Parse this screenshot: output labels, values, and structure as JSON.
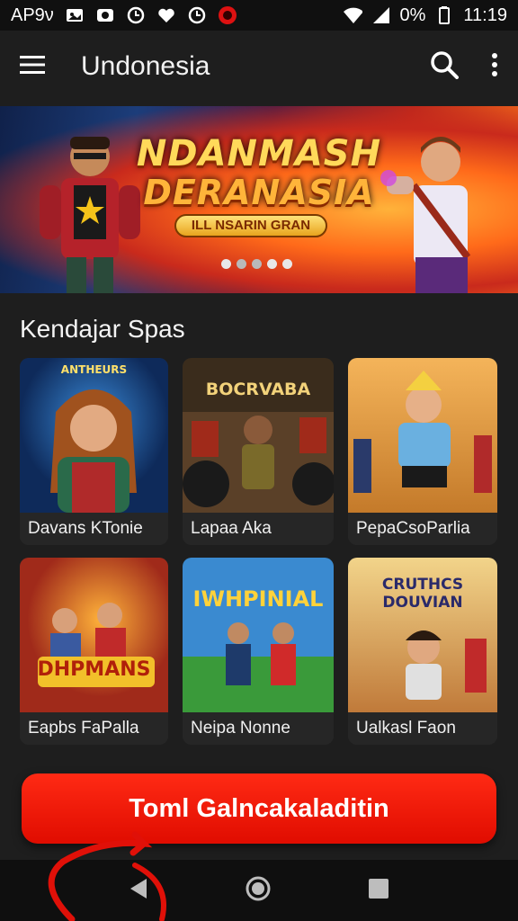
{
  "status_bar": {
    "carrier": "AP9ν",
    "battery": "0%",
    "time": "11:19"
  },
  "app_bar": {
    "title": "Undonesia",
    "icons": [
      "menu-icon",
      "search-icon",
      "more-vert-icon"
    ]
  },
  "banner": {
    "title_line1": "NDANMASH",
    "title_line2": "DERANASIA",
    "ribbon": "ILL NSARIN GRAN",
    "active_dot": 0,
    "dot_count": 5
  },
  "section": {
    "title": "Kendajar Spas"
  },
  "cards": [
    {
      "label": "Davans KTonie",
      "art_text": "ANTHEURS",
      "theme": "#1c4a8a"
    },
    {
      "label": "Lapaa Aka",
      "art_text": "BOCRVABA",
      "theme": "#4a3a24"
    },
    {
      "label": "PepaCsoParlia",
      "art_text": "",
      "theme": "#d88a2a"
    },
    {
      "label": "Eapbs FaPalla",
      "art_text": "DHPMANS",
      "theme": "#c0452a"
    },
    {
      "label": "Neipa Nonne",
      "art_text": "IWHPINIAL",
      "theme": "#2a7a3a"
    },
    {
      "label": "Ualkasl Faon",
      "art_text": "CRUTHCS DOUVIAN",
      "theme": "#c88a3a"
    }
  ],
  "cta": {
    "label": "Toml Galncakaladitin",
    "color": "#ee1a08"
  },
  "nav_bar": {
    "icons": [
      "back-icon",
      "home-icon",
      "recents-icon"
    ]
  }
}
